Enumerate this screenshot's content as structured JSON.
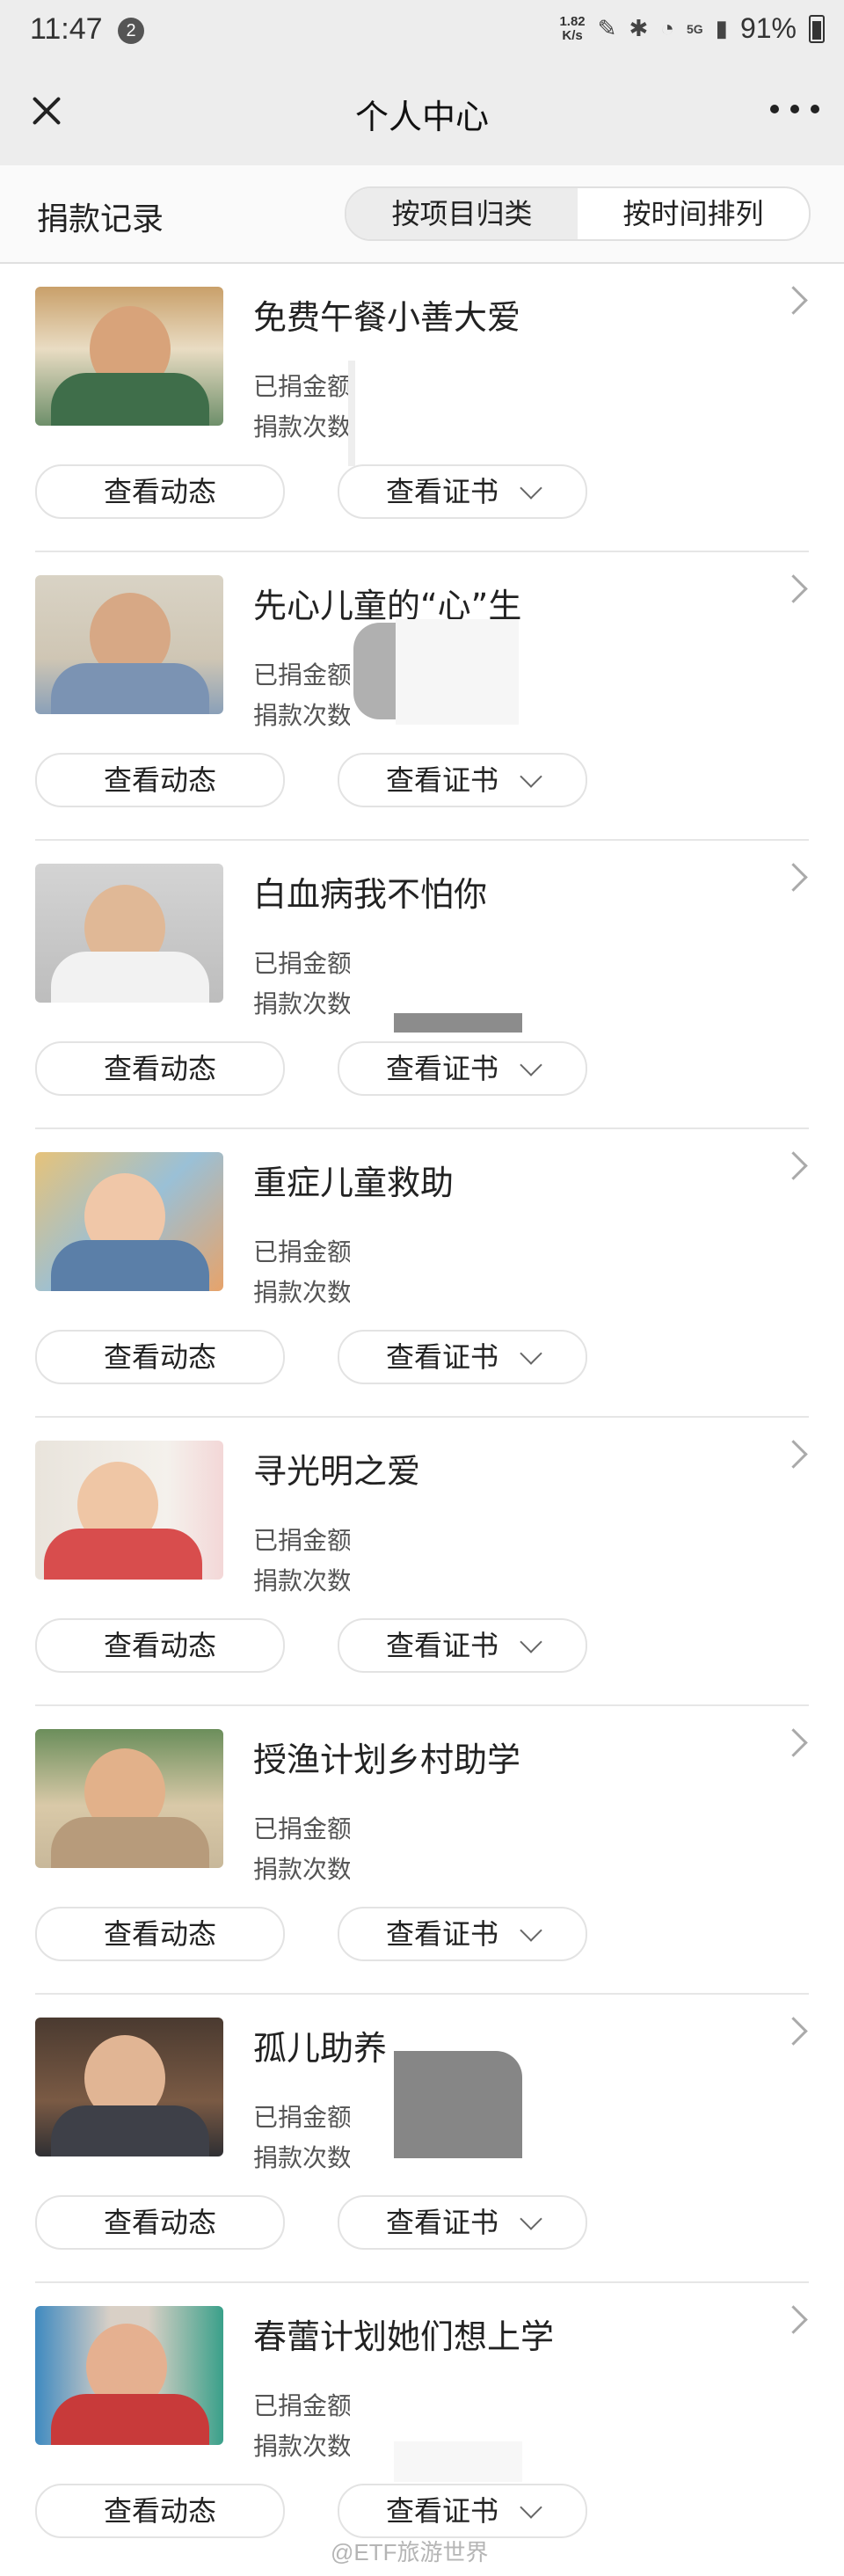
{
  "status_bar": {
    "time": "11:47",
    "notification_count": "2",
    "net_speed_value": "1.82",
    "net_speed_unit": "K/s",
    "network": "5G",
    "battery": "91%"
  },
  "header": {
    "title": "个人中心"
  },
  "tabs_bar": {
    "section_title": "捐款记录",
    "segments": [
      {
        "label": "按项目归类",
        "active": true
      },
      {
        "label": "按时间排列",
        "active": false
      }
    ]
  },
  "labels": {
    "amount": "已捐金额",
    "count": "捐款次数",
    "view_updates": "查看动态",
    "view_certificate": "查看证书"
  },
  "items": [
    {
      "title": "免费午餐小善大爱",
      "amount_label": "已捐金额",
      "count_label": "捐款次数",
      "updates_button": "查看动态",
      "certificate_button": "查看证书"
    },
    {
      "title": "先心儿童的“心”生",
      "amount_label": "已捐金额",
      "count_label": "捐款次数",
      "updates_button": "查看动态",
      "certificate_button": "查看证书"
    },
    {
      "title": "白血病我不怕你",
      "amount_label": "已捐金额",
      "count_label": "捐款次数",
      "updates_button": "查看动态",
      "certificate_button": "查看证书"
    },
    {
      "title": "重症儿童救助",
      "amount_label": "已捐金额",
      "count_label": "捐款次数",
      "updates_button": "查看动态",
      "certificate_button": "查看证书"
    },
    {
      "title": "寻光明之爱",
      "amount_label": "已捐金额",
      "count_label": "捐款次数",
      "updates_button": "查看动态",
      "certificate_button": "查看证书"
    },
    {
      "title": "授渔计划乡村助学",
      "amount_label": "已捐金额",
      "count_label": "捐款次数",
      "updates_button": "查看动态",
      "certificate_button": "查看证书"
    },
    {
      "title": "孤儿助养",
      "amount_label": "已捐金额",
      "count_label": "捐款次数",
      "updates_button": "查看动态",
      "certificate_button": "查看证书"
    },
    {
      "title": "春蕾计划她们想上学",
      "amount_label": "已捐金额",
      "count_label": "捐款次数",
      "updates_button": "查看动态",
      "certificate_button": "查看证书"
    }
  ],
  "watermark": "@ETF旅游世界",
  "colors": {
    "header_bg": "#ededed",
    "divider": "#e6e6e6",
    "segment_active": "#ececec"
  }
}
